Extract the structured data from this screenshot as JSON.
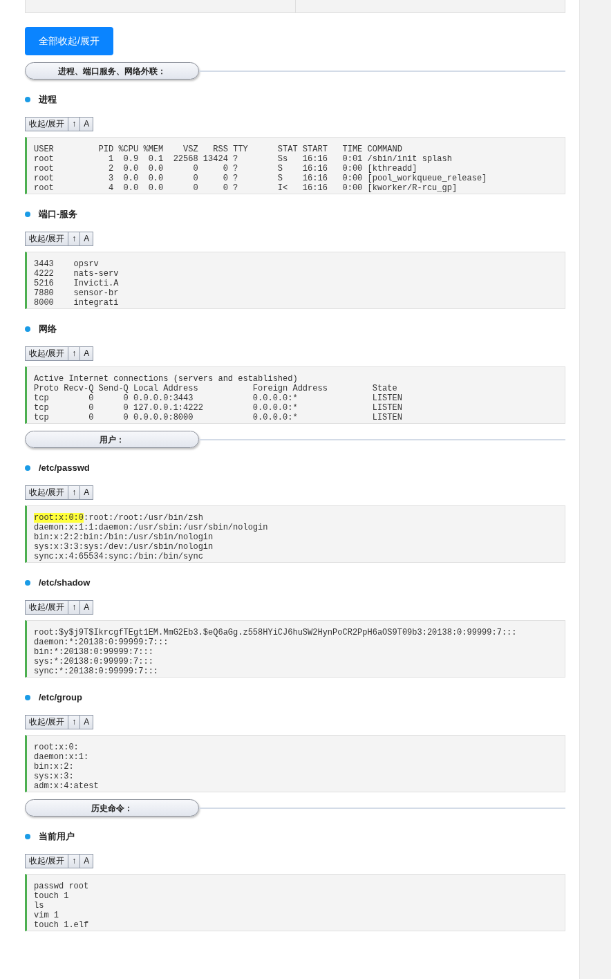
{
  "expand_all_button": "全部收起/展开",
  "sections": [
    {
      "title": "进程、端口服务、网络外联：",
      "groups": [
        {
          "label": "进程",
          "toolbar": [
            "收起/展开",
            "↑",
            "A"
          ],
          "lines": [
            "USER         PID %CPU %MEM    VSZ   RSS TTY      STAT START   TIME COMMAND",
            "root           1  0.9  0.1  22568 13424 ?        Ss   16:16   0:01 /sbin/init splash",
            "root           2  0.0  0.0      0     0 ?        S    16:16   0:00 [kthreadd]",
            "root           3  0.0  0.0      0     0 ?        S    16:16   0:00 [pool_workqueue_release]",
            "root           4  0.0  0.0      0     0 ?        I<   16:16   0:00 [kworker/R-rcu_gp]"
          ]
        },
        {
          "label": "端口-服务",
          "toolbar": [
            "收起/展开",
            "↑",
            "A"
          ],
          "lines": [
            "3443    opsrv",
            "4222    nats-serv",
            "5216    Invicti.A",
            "7880    sensor-br",
            "8000    integrati"
          ]
        },
        {
          "label": "网络",
          "toolbar": [
            "收起/展开",
            "↑",
            "A"
          ],
          "lines": [
            "Active Internet connections (servers and established)",
            "Proto Recv-Q Send-Q Local Address           Foreign Address         State",
            "tcp        0      0 0.0.0.0:3443            0.0.0.0:*               LISTEN",
            "tcp        0      0 127.0.0.1:4222          0.0.0.0:*               LISTEN",
            "tcp        0      0 0.0.0.0:8000            0.0.0.0:*               LISTEN"
          ]
        }
      ]
    },
    {
      "title": "用户：",
      "groups": [
        {
          "label": "/etc/passwd",
          "toolbar": [
            "收起/展开",
            "↑",
            "A"
          ],
          "lines": [
            {
              "marked": "root:x:0:0",
              "text": ":root:/root:/usr/bin/zsh"
            },
            "daemon:x:1:1:daemon:/usr/sbin:/usr/sbin/nologin",
            "bin:x:2:2:bin:/bin:/usr/sbin/nologin",
            "sys:x:3:3:sys:/dev:/usr/sbin/nologin",
            "sync:x:4:65534:sync:/bin:/bin/sync"
          ]
        },
        {
          "label": "/etc/shadow",
          "toolbar": [
            "收起/展开",
            "↑",
            "A"
          ],
          "lines": [
            "root:$y$j9T$IkrcgfTEgt1EM.MmG2Eb3.$eQ6aGg.z558HYiCJ6huSW2HynPoCR2PpH6aOS9T09b3:20138:0:99999:7:::",
            "daemon:*:20138:0:99999:7:::",
            "bin:*:20138:0:99999:7:::",
            "sys:*:20138:0:99999:7:::",
            "sync:*:20138:0:99999:7:::"
          ]
        },
        {
          "label": "/etc/group",
          "toolbar": [
            "收起/展开",
            "↑",
            "A"
          ],
          "lines": [
            "root:x:0:",
            "daemon:x:1:",
            "bin:x:2:",
            "sys:x:3:",
            "adm:x:4:atest"
          ]
        }
      ]
    },
    {
      "title": "历史命令：",
      "groups": [
        {
          "label": "当前用户",
          "toolbar": [
            "收起/展开",
            "↑",
            "A"
          ],
          "lines": [
            "passwd root",
            "touch 1",
            "ls",
            "vim 1",
            "touch 1.elf"
          ]
        }
      ]
    }
  ]
}
